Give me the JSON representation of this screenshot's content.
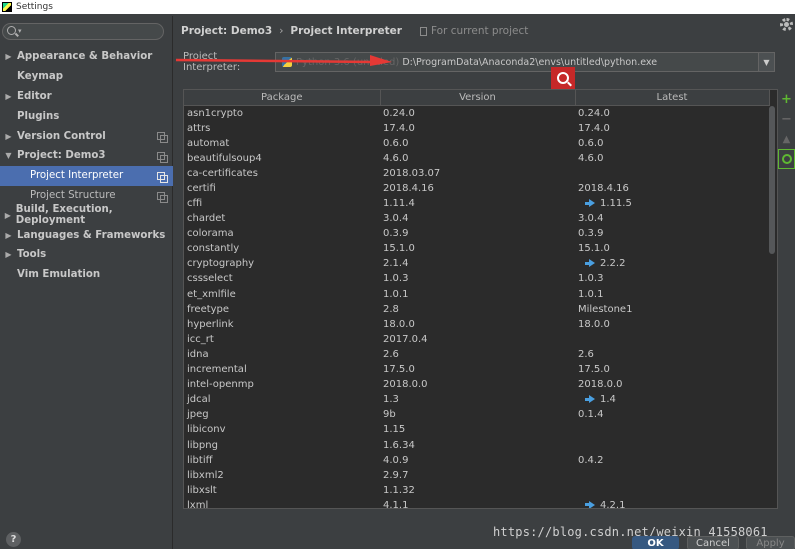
{
  "window": {
    "title": "Settings"
  },
  "sidebar": {
    "items": [
      {
        "label": "Appearance & Behavior",
        "arrow": "▶",
        "copy": false
      },
      {
        "label": "Keymap",
        "arrow": "",
        "copy": false
      },
      {
        "label": "Editor",
        "arrow": "▶",
        "copy": false
      },
      {
        "label": "Plugins",
        "arrow": "",
        "copy": false
      },
      {
        "label": "Version Control",
        "arrow": "▶",
        "copy": true
      },
      {
        "label": "Project: Demo3",
        "arrow": "▼",
        "copy": true
      },
      {
        "label": "Project Interpreter",
        "sub": true,
        "selected": true,
        "copy": true
      },
      {
        "label": "Project Structure",
        "sub": true,
        "copy": true
      },
      {
        "label": "Build, Execution, Deployment",
        "arrow": "▶",
        "copy": false
      },
      {
        "label": "Languages & Frameworks",
        "arrow": "▶",
        "copy": false
      },
      {
        "label": "Tools",
        "arrow": "▶",
        "copy": false
      },
      {
        "label": "Vim Emulation",
        "arrow": "",
        "copy": false
      }
    ]
  },
  "header": {
    "project": "Project: Demo3",
    "separator": "›",
    "page": "Project Interpreter",
    "scope": "For current project"
  },
  "interpreter": {
    "label": "Project Interpreter:",
    "obscured": "Python 3.6 (untitled)",
    "path": "D:\\ProgramData\\Anaconda2\\envs\\untitled\\python.exe",
    "dropdown": "▼"
  },
  "table": {
    "columns": [
      "Package",
      "Version",
      "Latest"
    ],
    "rows": [
      {
        "package": "asn1crypto",
        "version": "0.24.0",
        "latest": "0.24.0",
        "upgrade": false
      },
      {
        "package": "attrs",
        "version": "17.4.0",
        "latest": "17.4.0",
        "upgrade": false
      },
      {
        "package": "automat",
        "version": "0.6.0",
        "latest": "0.6.0",
        "upgrade": false
      },
      {
        "package": "beautifulsoup4",
        "version": "4.6.0",
        "latest": "4.6.0",
        "upgrade": false
      },
      {
        "package": "ca-certificates",
        "version": "2018.03.07",
        "latest": "",
        "upgrade": false
      },
      {
        "package": "certifi",
        "version": "2018.4.16",
        "latest": "2018.4.16",
        "upgrade": false
      },
      {
        "package": "cffi",
        "version": "1.11.4",
        "latest": "1.11.5",
        "upgrade": true
      },
      {
        "package": "chardet",
        "version": "3.0.4",
        "latest": "3.0.4",
        "upgrade": false
      },
      {
        "package": "colorama",
        "version": "0.3.9",
        "latest": "0.3.9",
        "upgrade": false
      },
      {
        "package": "constantly",
        "version": "15.1.0",
        "latest": "15.1.0",
        "upgrade": false
      },
      {
        "package": "cryptography",
        "version": "2.1.4",
        "latest": "2.2.2",
        "upgrade": true
      },
      {
        "package": "cssselect",
        "version": "1.0.3",
        "latest": "1.0.3",
        "upgrade": false
      },
      {
        "package": "et_xmlfile",
        "version": "1.0.1",
        "latest": "1.0.1",
        "upgrade": false
      },
      {
        "package": "freetype",
        "version": "2.8",
        "latest": "Milestone1",
        "upgrade": false
      },
      {
        "package": "hyperlink",
        "version": "18.0.0",
        "latest": "18.0.0",
        "upgrade": false
      },
      {
        "package": "icc_rt",
        "version": "2017.0.4",
        "latest": "",
        "upgrade": false
      },
      {
        "package": "idna",
        "version": "2.6",
        "latest": "2.6",
        "upgrade": false
      },
      {
        "package": "incremental",
        "version": "17.5.0",
        "latest": "17.5.0",
        "upgrade": false
      },
      {
        "package": "intel-openmp",
        "version": "2018.0.0",
        "latest": "2018.0.0",
        "upgrade": false
      },
      {
        "package": "jdcal",
        "version": "1.3",
        "latest": "1.4",
        "upgrade": true
      },
      {
        "package": "jpeg",
        "version": "9b",
        "latest": "0.1.4",
        "upgrade": false
      },
      {
        "package": "libiconv",
        "version": "1.15",
        "latest": "",
        "upgrade": false
      },
      {
        "package": "libpng",
        "version": "1.6.34",
        "latest": "",
        "upgrade": false
      },
      {
        "package": "libtiff",
        "version": "4.0.9",
        "latest": "0.4.2",
        "upgrade": false
      },
      {
        "package": "libxml2",
        "version": "2.9.7",
        "latest": "",
        "upgrade": false
      },
      {
        "package": "libxslt",
        "version": "1.1.32",
        "latest": "",
        "upgrade": false
      },
      {
        "package": "lxml",
        "version": "4.1.1",
        "latest": "4.2.1",
        "upgrade": true
      }
    ]
  },
  "tools": {
    "add": "+",
    "remove": "−",
    "up": "▲"
  },
  "footer": {
    "help": "?",
    "ok": "OK",
    "cancel": "Cancel",
    "apply": "Apply",
    "watermark": "https://blog.csdn.net/weixin_41558061"
  },
  "colors": {
    "selection": "#4b6eaf",
    "accent_green": "#5fb832",
    "annotation_red": "#e53935",
    "upgrade_blue": "#4a9fe0"
  }
}
